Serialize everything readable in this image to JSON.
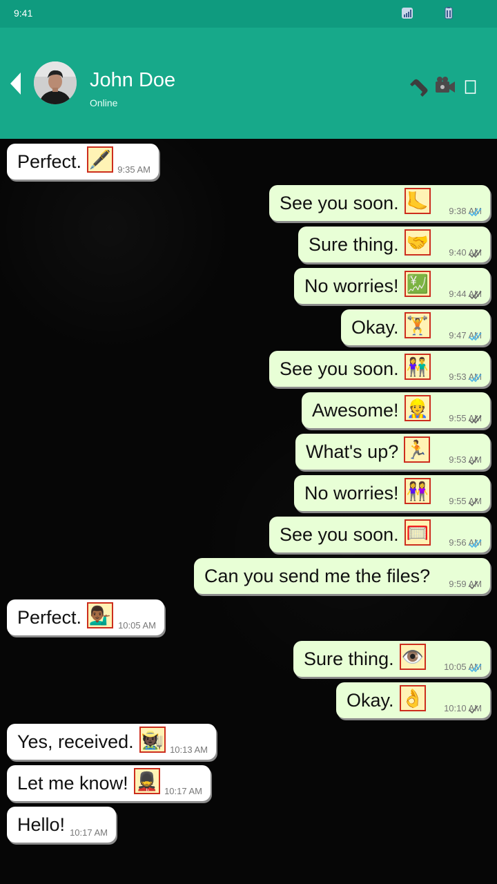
{
  "status_bar": {
    "time": "9:41",
    "signal_icon": "signal-icon",
    "battery_icon": "battery-icon"
  },
  "header": {
    "contact_name": "John Doe",
    "contact_status": "Online",
    "icons": [
      "back-arrow-icon",
      "phone-icon",
      "video-camera-icon",
      "more-menu-icon"
    ]
  },
  "colors": {
    "status_bar": "#0f9b7f",
    "header": "#17a98a",
    "outgoing": "#e8ffd6",
    "incoming": "#ffffff",
    "read_tick": "#4fb5e6"
  },
  "messages": [
    {
      "dir": "in",
      "text": "Perfect.",
      "emoji": "🖋️",
      "emoji_name": "fountain-pen-emoji",
      "time": "9:35 AM"
    },
    {
      "dir": "out",
      "text": "See you soon.",
      "emoji": "🦶",
      "emoji_name": "foot-emoji",
      "time": "9:38 AM",
      "status": "read"
    },
    {
      "dir": "out",
      "text": "Sure thing.",
      "emoji": "🤝",
      "emoji_name": "handshake-emoji",
      "time": "9:40 AM",
      "status": "delivered"
    },
    {
      "dir": "out",
      "text": "No worries!",
      "emoji": "💹",
      "emoji_name": "chart-yen-emoji",
      "time": "9:44 AM",
      "status": "delivered"
    },
    {
      "dir": "out",
      "text": "Okay.",
      "emoji": "🏋️",
      "emoji_name": "weightlifter-emoji",
      "time": "9:47 AM",
      "status": "read"
    },
    {
      "dir": "out",
      "text": "See you soon.",
      "emoji": "👫",
      "emoji_name": "couple-emoji",
      "time": "9:53 AM",
      "status": "read"
    },
    {
      "dir": "out",
      "text": "Awesome!",
      "emoji": "👷",
      "emoji_name": "construction-worker-emoji",
      "time": "9:55 AM",
      "status": "delivered"
    },
    {
      "dir": "out",
      "text": "What's up?",
      "emoji": "🏃",
      "emoji_name": "runner-emoji",
      "time": "9:53 AM",
      "status": "sent"
    },
    {
      "dir": "out",
      "text": "No worries!",
      "emoji": "👭",
      "emoji_name": "women-holding-hands-emoji",
      "time": "9:55 AM",
      "status": "sent"
    },
    {
      "dir": "out",
      "text": "See you soon.",
      "emoji": "🥅",
      "emoji_name": "goal-net-emoji",
      "time": "9:56 AM",
      "status": "read"
    },
    {
      "dir": "out",
      "text": "Can you send me the files?",
      "emoji": "",
      "emoji_name": "",
      "time": "9:59 AM",
      "status": "sent"
    },
    {
      "dir": "in",
      "text": "Perfect.",
      "emoji": "💁🏾‍♂️",
      "emoji_name": "person-tipping-hand-emoji",
      "time": "10:05 AM"
    },
    {
      "dir": "out",
      "text": "Sure thing.",
      "emoji": "👁️",
      "emoji_name": "eye-emoji",
      "time": "10:05 AM",
      "status": "read"
    },
    {
      "dir": "out",
      "text": "Okay.",
      "emoji": "👌",
      "emoji_name": "ok-hand-emoji",
      "time": "10:10 AM",
      "status": "sent"
    },
    {
      "dir": "in",
      "text": "Yes, received.",
      "emoji": "🧑🏿‍🌾",
      "emoji_name": "farmer-emoji",
      "time": "10:13 AM"
    },
    {
      "dir": "in",
      "text": "Let me know!",
      "emoji": "💂",
      "emoji_name": "guard-emoji",
      "time": "10:17 AM"
    },
    {
      "dir": "in",
      "text": "Hello!",
      "emoji": "",
      "emoji_name": "",
      "time": "10:17 AM"
    }
  ]
}
